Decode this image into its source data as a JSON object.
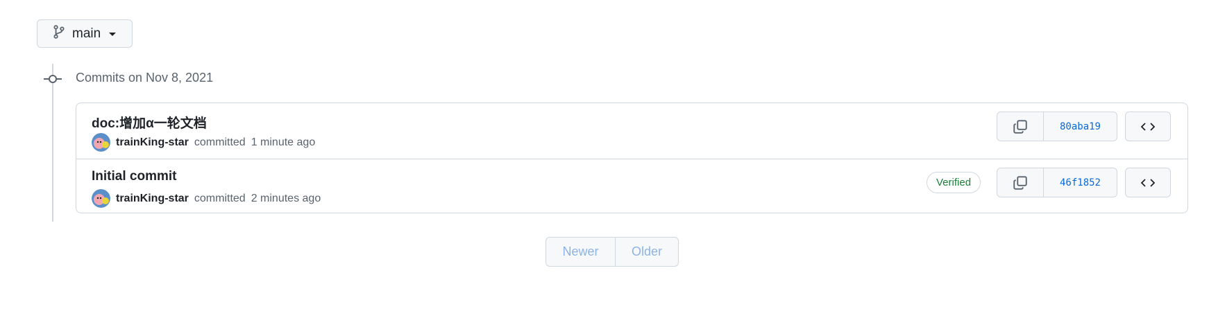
{
  "branch": {
    "name": "main"
  },
  "commit_group": {
    "title": "Commits on Nov 8, 2021"
  },
  "commits": [
    {
      "message": "doc:增加α一轮文档",
      "author": "trainKing-star",
      "action": "committed",
      "time": "1 minute ago",
      "sha": "80aba19",
      "verified": ""
    },
    {
      "message": "Initial commit",
      "author": "trainKing-star",
      "action": "committed",
      "time": "2 minutes ago",
      "sha": "46f1852",
      "verified": "Verified"
    }
  ],
  "pagination": {
    "newer": "Newer",
    "older": "Older"
  },
  "colors": {
    "link": "#0969da",
    "verified": "#1a7f37",
    "border": "#d0d7de",
    "muted": "#59636e",
    "disabled": "#8cb4e6"
  }
}
